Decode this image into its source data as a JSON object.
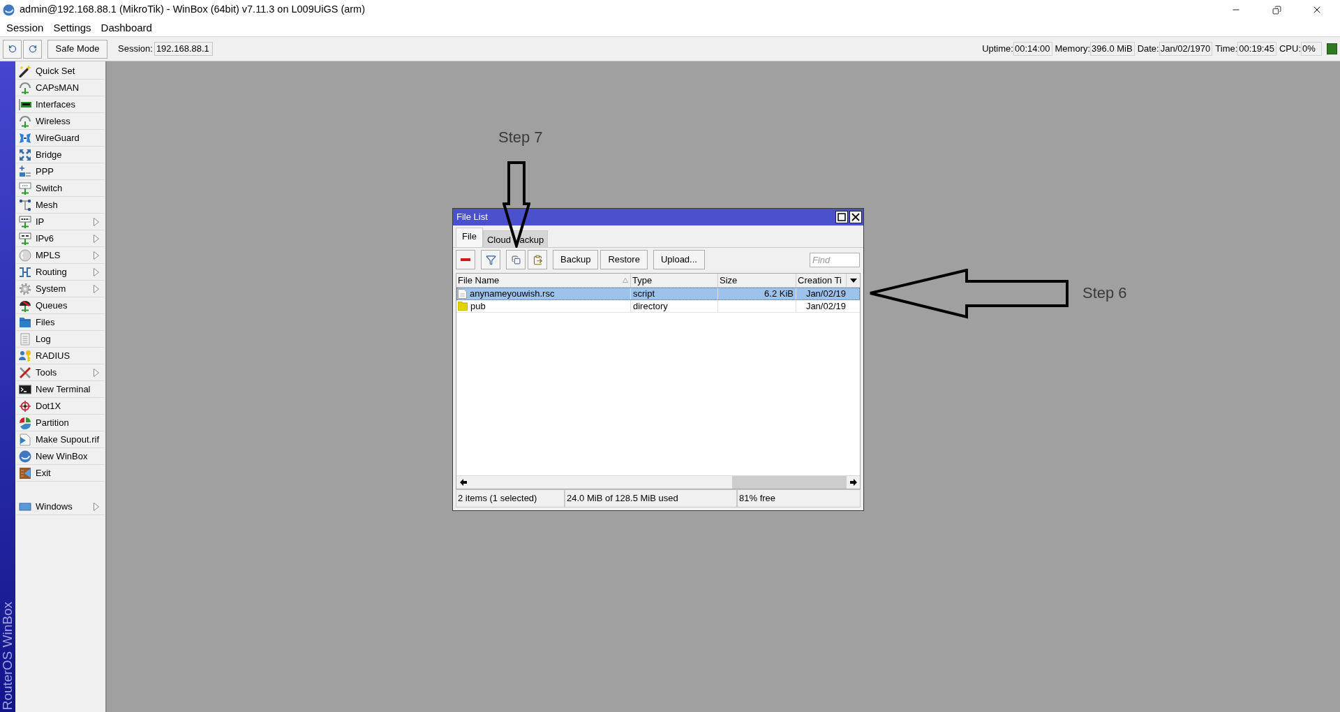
{
  "window": {
    "title": "admin@192.168.88.1 (MikroTik) - WinBox (64bit) v7.11.3 on L009UiGS (arm)",
    "menu": [
      "Session",
      "Settings",
      "Dashboard"
    ]
  },
  "toolbar": {
    "safe_mode": {
      "label": "Safe Mode",
      "on": false
    },
    "session": {
      "label": "Session:",
      "value": "192.168.88.1"
    },
    "status": [
      {
        "label": "Uptime:",
        "value": "00:14:00"
      },
      {
        "label": "Memory:",
        "value": "396.0 MiB"
      },
      {
        "label": "Date:",
        "value": "Jan/02/1970"
      },
      {
        "label": "Time:",
        "value": "00:19:45"
      },
      {
        "label": "CPU:",
        "value": "0%"
      }
    ]
  },
  "sidebar": {
    "groups": [
      {
        "items": [
          {
            "label": "Quick Set",
            "submenu": false
          },
          {
            "label": "CAPsMAN",
            "submenu": false
          },
          {
            "label": "Interfaces",
            "submenu": false
          },
          {
            "label": "Wireless",
            "submenu": false
          },
          {
            "label": "WireGuard",
            "submenu": false
          },
          {
            "label": "Bridge",
            "submenu": false
          },
          {
            "label": "PPP",
            "submenu": false
          },
          {
            "label": "Switch",
            "submenu": false
          },
          {
            "label": "Mesh",
            "submenu": false
          },
          {
            "label": "IP",
            "submenu": true
          },
          {
            "label": "IPv6",
            "submenu": true
          },
          {
            "label": "MPLS",
            "submenu": true
          },
          {
            "label": "Routing",
            "submenu": true
          },
          {
            "label": "System",
            "submenu": true
          },
          {
            "label": "Queues",
            "submenu": false
          },
          {
            "label": "Files",
            "submenu": false
          },
          {
            "label": "Log",
            "submenu": false
          },
          {
            "label": "RADIUS",
            "submenu": false
          },
          {
            "label": "Tools",
            "submenu": true
          },
          {
            "label": "New Terminal",
            "submenu": false
          },
          {
            "label": "Dot1X",
            "submenu": false
          },
          {
            "label": "Partition",
            "submenu": false
          },
          {
            "label": "Make Supout.rif",
            "submenu": false
          },
          {
            "label": "New WinBox",
            "submenu": false
          },
          {
            "label": "Exit",
            "submenu": false
          }
        ]
      },
      {
        "items": [
          {
            "label": "Windows",
            "submenu": true
          }
        ]
      }
    ],
    "brand": "RouterOS WinBox"
  },
  "file_list": {
    "title": "File List",
    "tabs": [
      {
        "label": "File",
        "selected": true
      },
      {
        "label": "Cloud ackup",
        "selected": false
      }
    ],
    "buttons": [
      "Backup",
      "Restore",
      "Upload..."
    ],
    "search": {
      "placeholder": "Find"
    },
    "columns": [
      "File Name",
      "Type",
      "Size",
      "Creation Ti"
    ],
    "rows": [
      {
        "kind": "file",
        "selected": true,
        "name": "anynameyouwish.rsc",
        "type": "script",
        "size": "6.2 KiB",
        "created": "Jan/02/19"
      },
      {
        "kind": "folder",
        "selected": false,
        "name": "pub",
        "type": "directory",
        "created": "Jan/02/19"
      }
    ],
    "status": [
      "2 items (1 selected)",
      "24.0 MiB of 128.5 MiB used",
      "81% free"
    ]
  },
  "annotations": [
    {
      "kind": "down",
      "label": "Step 7"
    },
    {
      "kind": "left",
      "label": "Step 6"
    }
  ]
}
